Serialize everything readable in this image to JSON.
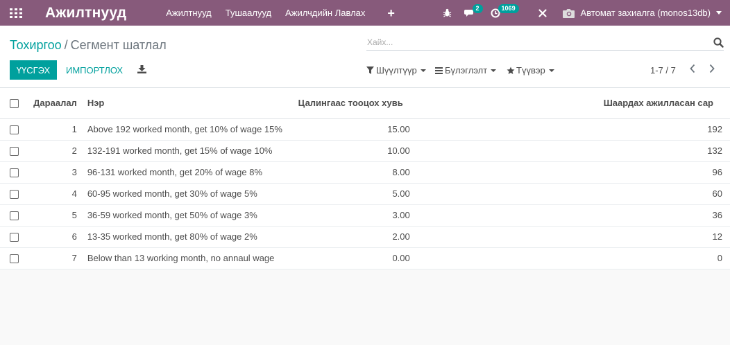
{
  "navbar": {
    "app_title": "Ажилтнууд",
    "menu": [
      "Ажилтнууд",
      "Тушаалууд",
      "Ажилчдийн Лавлах"
    ],
    "messages_badge": "2",
    "activity_badge": "1069",
    "company": "Автомат захиалга (monos13db)"
  },
  "breadcrumb": {
    "parent": "Тохиргоо",
    "separator": "/",
    "current": "Сегмент шатлал"
  },
  "search": {
    "placeholder": "Хайх..."
  },
  "toolbar": {
    "create_label": "ҮҮСГЭХ",
    "import_label": "ИМПОРТЛОХ",
    "filters_label": "Шүүлтүүр",
    "group_label": "Бүлэглэлт",
    "favorites_label": "Түүвэр"
  },
  "pager": {
    "value": "1-7 / 7"
  },
  "table": {
    "headers": {
      "sequence": "Дараалал",
      "name": "Нэр",
      "rate": "Цалингаас тооцох хувь",
      "months": "Шаардах ажилласан сар"
    },
    "rows": [
      {
        "sequence": "1",
        "name": "Above 192 worked month, get 10% of wage 15%",
        "rate": "15.00",
        "months": "192"
      },
      {
        "sequence": "2",
        "name": "132-191 worked month, get 15% of wage 10%",
        "rate": "10.00",
        "months": "132"
      },
      {
        "sequence": "3",
        "name": "96-131 worked month, get 20% of wage 8%",
        "rate": "8.00",
        "months": "96"
      },
      {
        "sequence": "4",
        "name": "60-95 worked month, get 30% of wage 5%",
        "rate": "5.00",
        "months": "60"
      },
      {
        "sequence": "5",
        "name": "36-59 worked month, get 50% of wage 3%",
        "rate": "3.00",
        "months": "36"
      },
      {
        "sequence": "6",
        "name": "13-35 worked month, get 80% of wage 2%",
        "rate": "2.00",
        "months": "12"
      },
      {
        "sequence": "7",
        "name": "Below than 13 working month, no annaul wage",
        "rate": "0.00",
        "months": "0"
      }
    ]
  },
  "colors": {
    "navbar": "#875a7b",
    "primary": "#00a09d",
    "badge": "#00a09d"
  }
}
